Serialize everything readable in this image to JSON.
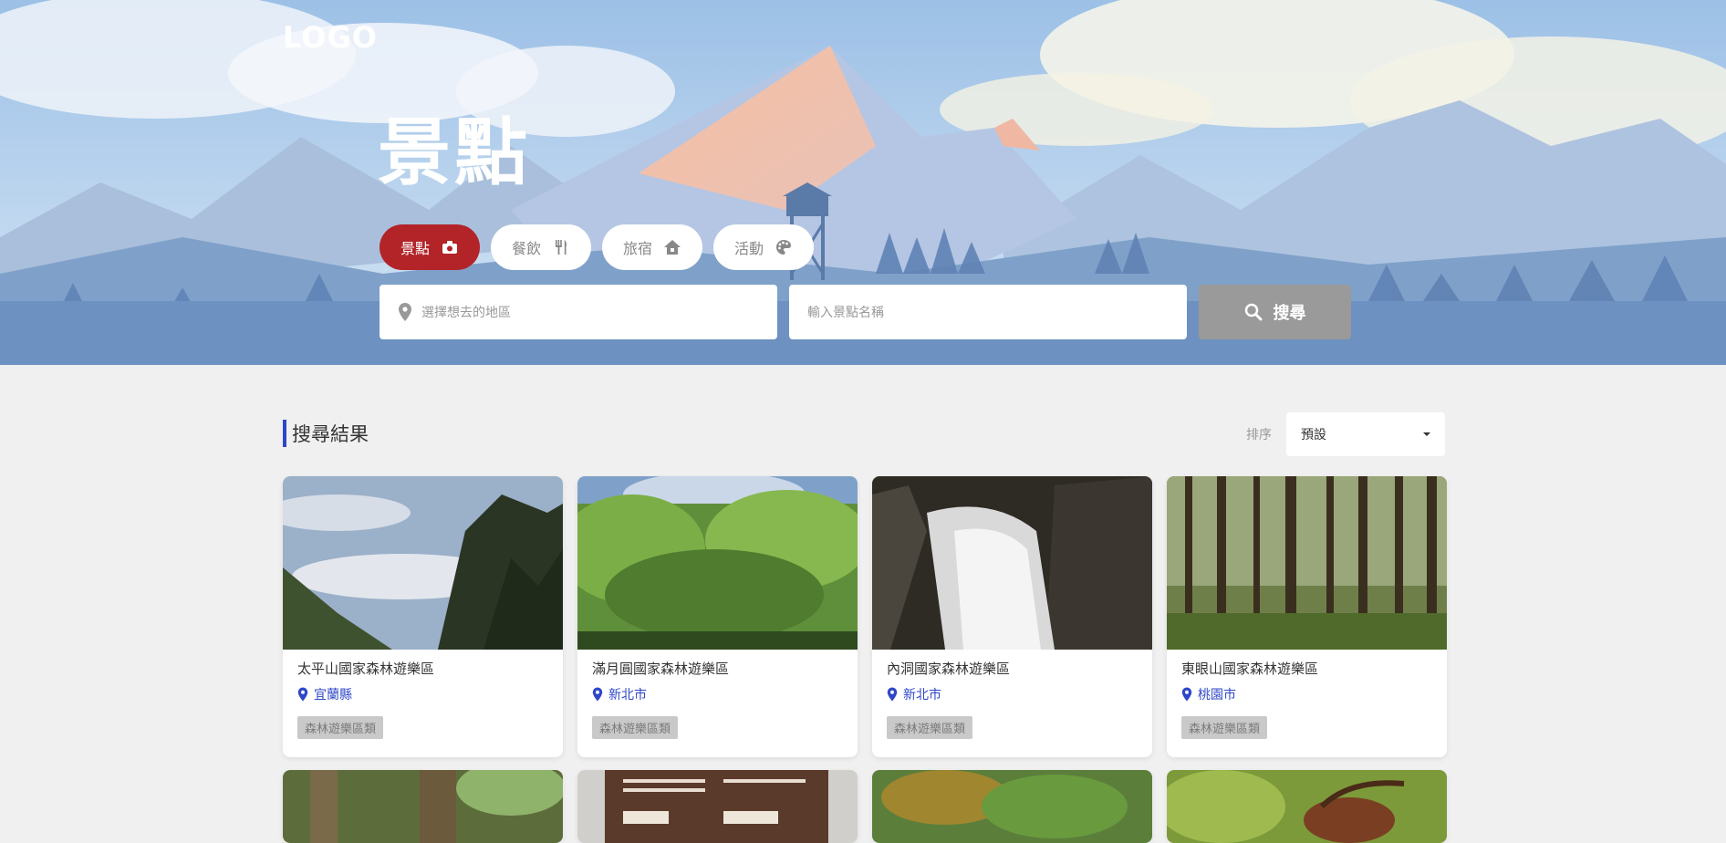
{
  "brand": {
    "logo": "LOGO"
  },
  "hero": {
    "title": "景點"
  },
  "tabs": [
    {
      "label": "景點",
      "icon": "camera-icon",
      "active": true
    },
    {
      "label": "餐飲",
      "icon": "utensils-icon",
      "active": false
    },
    {
      "label": "旅宿",
      "icon": "house-icon",
      "active": false
    },
    {
      "label": "活動",
      "icon": "palette-icon",
      "active": false
    }
  ],
  "search": {
    "region_placeholder": "選擇想去的地區",
    "name_placeholder": "輸入景點名稱",
    "button_label": "搜尋"
  },
  "results": {
    "title": "搜尋結果",
    "sort_label": "排序",
    "sort_value": "預設",
    "cards": [
      {
        "name": "太平山國家森林遊樂區",
        "location": "宜蘭縣",
        "tag": "森林遊樂區類"
      },
      {
        "name": "滿月圓國家森林遊樂區",
        "location": "新北市",
        "tag": "森林遊樂區類"
      },
      {
        "name": "內洞國家森林遊樂區",
        "location": "新北市",
        "tag": "森林遊樂區類"
      },
      {
        "name": "東眼山國家森林遊樂區",
        "location": "桃園市",
        "tag": "森林遊樂區類"
      }
    ]
  },
  "colors": {
    "accent": "#b22428",
    "link": "#2f47c7",
    "search_button": "#9a9a9a"
  }
}
